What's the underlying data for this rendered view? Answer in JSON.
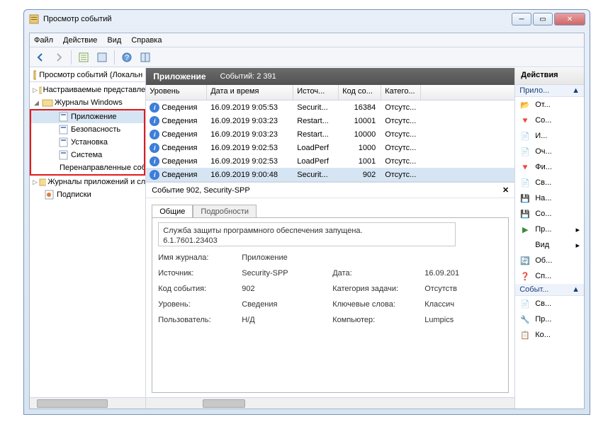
{
  "window": {
    "title": "Просмотр событий"
  },
  "menu": {
    "file": "Файл",
    "action": "Действие",
    "view": "Вид",
    "help": "Справка"
  },
  "tree": {
    "root": "Просмотр событий (Локальн",
    "custom": "Настраиваемые представле",
    "winlogs": "Журналы Windows",
    "items": [
      {
        "label": "Приложение"
      },
      {
        "label": "Безопасность"
      },
      {
        "label": "Установка"
      },
      {
        "label": "Система"
      },
      {
        "label": "Перенаправленные соб"
      }
    ],
    "applogs": "Журналы приложений и сл",
    "subs": "Подписки"
  },
  "header": {
    "title": "Приложение",
    "count": "Событий: 2 391"
  },
  "grid": {
    "cols": [
      "Уровень",
      "Дата и время",
      "Источ...",
      "Код со...",
      "Катего..."
    ],
    "rows": [
      {
        "lvl": "Сведения",
        "dt": "16.09.2019 9:05:53",
        "src": "Securit...",
        "id": "16384",
        "cat": "Отсутс..."
      },
      {
        "lvl": "Сведения",
        "dt": "16.09.2019 9:03:23",
        "src": "Restart...",
        "id": "10001",
        "cat": "Отсутс..."
      },
      {
        "lvl": "Сведения",
        "dt": "16.09.2019 9:03:23",
        "src": "Restart...",
        "id": "10000",
        "cat": "Отсутс..."
      },
      {
        "lvl": "Сведения",
        "dt": "16.09.2019 9:02:53",
        "src": "LoadPerf",
        "id": "1000",
        "cat": "Отсутс..."
      },
      {
        "lvl": "Сведения",
        "dt": "16.09.2019 9:02:53",
        "src": "LoadPerf",
        "id": "1001",
        "cat": "Отсутс..."
      },
      {
        "lvl": "Сведения",
        "dt": "16.09.2019 9:00:48",
        "src": "Securit...",
        "id": "902",
        "cat": "Отсутс..."
      }
    ]
  },
  "detail": {
    "title": "Событие 902, Security-SPP",
    "tabs": {
      "general": "Общие",
      "details": "Подробности"
    },
    "desc": "Служба защиты программного обеспечения запущена.",
    "desc2": "6.1.7601.23403",
    "kv": {
      "logname_k": "Имя журнала:",
      "logname_v": "Приложение",
      "source_k": "Источник:",
      "source_v": "Security-SPP",
      "date_k": "Дата:",
      "date_v": "16.09.201",
      "eventid_k": "Код события:",
      "eventid_v": "902",
      "taskcat_k": "Категория задачи:",
      "taskcat_v": "Отсутств",
      "level_k": "Уровень:",
      "level_v": "Сведения",
      "keywords_k": "Ключевые слова:",
      "keywords_v": "Классич",
      "user_k": "Пользователь:",
      "user_v": "Н/Д",
      "computer_k": "Компьютер:",
      "computer_v": "Lumpics"
    }
  },
  "actions": {
    "title": "Действия",
    "group1": "Прило...",
    "items1": [
      "От...",
      "Со...",
      "И...",
      "Оч...",
      "Фи...",
      "Св...",
      "На...",
      "Со...",
      "Пр...",
      "Вид",
      "Об...",
      "Сп..."
    ],
    "group2": "Событ...",
    "items2": [
      "Св...",
      "Пр...",
      "Ко..."
    ]
  }
}
